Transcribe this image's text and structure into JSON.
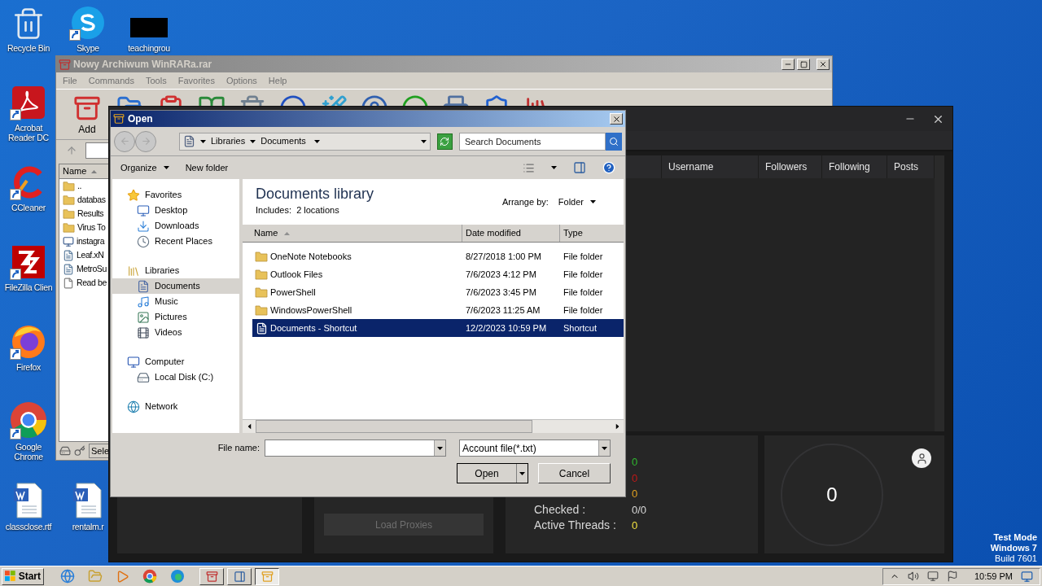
{
  "desktop_icons": [
    {
      "label": "Recycle Bin",
      "kind": "recycle_bin",
      "shortcut": false
    },
    {
      "label": "Skype",
      "kind": "skype",
      "shortcut": true
    },
    {
      "label": "teachingrou",
      "kind": "redacted",
      "shortcut": false
    },
    {
      "label": "Acrobat Reader DC",
      "kind": "acrobat",
      "shortcut": true
    },
    {
      "label": "CCleaner",
      "kind": "ccleaner",
      "shortcut": true
    },
    {
      "label": "FileZilla Clien",
      "kind": "filezilla",
      "shortcut": true
    },
    {
      "label": "Firefox",
      "kind": "firefox",
      "shortcut": true
    },
    {
      "label": "Google Chrome",
      "kind": "chrome",
      "shortcut": true
    },
    {
      "label": "classclose.rtf",
      "kind": "word_doc",
      "shortcut": false
    },
    {
      "label": "rentalm.r",
      "kind": "word_doc",
      "shortcut": false
    }
  ],
  "winrar": {
    "title": "Nowy Archiwum WinRARa.rar",
    "menu": [
      "File",
      "Commands",
      "Tools",
      "Favorites",
      "Options",
      "Help"
    ],
    "toolbar": [
      {
        "label": "Add"
      }
    ],
    "name_column": "Name",
    "files": [
      {
        "name": "..",
        "kind": "folder"
      },
      {
        "name": "databas",
        "kind": "folder"
      },
      {
        "name": "Results",
        "kind": "folder"
      },
      {
        "name": "Virus To",
        "kind": "folder"
      },
      {
        "name": "instagra",
        "kind": "app"
      },
      {
        "name": "Leaf.xN",
        "kind": "file"
      },
      {
        "name": "MetroSu",
        "kind": "file"
      },
      {
        "name": "Read be",
        "kind": "text"
      }
    ],
    "status": "Sele"
  },
  "checker": {
    "columns": [
      "Username",
      "Followers",
      "Following",
      "Posts"
    ],
    "load_button": "Load Proxies",
    "stats": [
      {
        "value": "0",
        "color": "#2fb82f"
      },
      {
        "value": "0",
        "color": "#c01818"
      },
      {
        "value": "0",
        "color": "#e0a020"
      },
      {
        "label": "Checked :",
        "value": "0/0",
        "color": "#d8d8d8"
      },
      {
        "label": "Active Threads :",
        "value": "0",
        "color": "#f0e040"
      }
    ],
    "gauge": "0"
  },
  "dialog": {
    "title": "Open",
    "breadcrumb": [
      "Libraries",
      "Documents"
    ],
    "search_placeholder": "Search Documents",
    "commands": [
      "Organize",
      "New folder"
    ],
    "nav": [
      {
        "label": "Favorites",
        "kind": "favorites",
        "selected": false,
        "children": [
          {
            "label": "Desktop",
            "kind": "desktop",
            "selected": false
          },
          {
            "label": "Downloads",
            "kind": "downloads",
            "selected": false
          },
          {
            "label": "Recent Places",
            "kind": "recent",
            "selected": false
          }
        ]
      },
      {
        "label": "Libraries",
        "kind": "libraries",
        "selected": false,
        "children": [
          {
            "label": "Documents",
            "kind": "documents",
            "selected": true
          },
          {
            "label": "Music",
            "kind": "music",
            "selected": false
          },
          {
            "label": "Pictures",
            "kind": "pictures",
            "selected": false
          },
          {
            "label": "Videos",
            "kind": "videos",
            "selected": false
          }
        ]
      },
      {
        "label": "Computer",
        "kind": "computer",
        "selected": false,
        "children": [
          {
            "label": "Local Disk (C:)",
            "kind": "disk",
            "selected": false
          }
        ]
      },
      {
        "label": "Network",
        "kind": "network",
        "selected": false
      }
    ],
    "library_title": "Documents library",
    "library_includes": "Includes:  2 locations",
    "arrange_label": "Arrange by:",
    "arrange_value": "Folder",
    "columns": [
      "Name",
      "Date modified",
      "Type"
    ],
    "rows": [
      {
        "name": "OneNote Notebooks",
        "date": "8/27/2018 1:00 PM",
        "type": "File folder",
        "kind": "folder",
        "selected": false
      },
      {
        "name": "Outlook Files",
        "date": "7/6/2023 4:12 PM",
        "type": "File folder",
        "kind": "folder",
        "selected": false
      },
      {
        "name": "PowerShell",
        "date": "7/6/2023 3:45 PM",
        "type": "File folder",
        "kind": "folder",
        "selected": false
      },
      {
        "name": "WindowsPowerShell",
        "date": "7/6/2023 11:25 AM",
        "type": "File folder",
        "kind": "folder",
        "selected": false
      },
      {
        "name": "Documents - Shortcut",
        "date": "12/2/2023 10:59 PM",
        "type": "Shortcut",
        "kind": "shortcut",
        "selected": true
      }
    ],
    "file_name_label": "File name:",
    "filter": "Account file(*.txt)",
    "buttons": [
      "Open",
      "Cancel"
    ]
  },
  "taskbar": {
    "start": "Start",
    "time": "10:59 PM"
  },
  "os_notice": [
    "Test Mode",
    "Windows 7",
    "Build 7601"
  ]
}
